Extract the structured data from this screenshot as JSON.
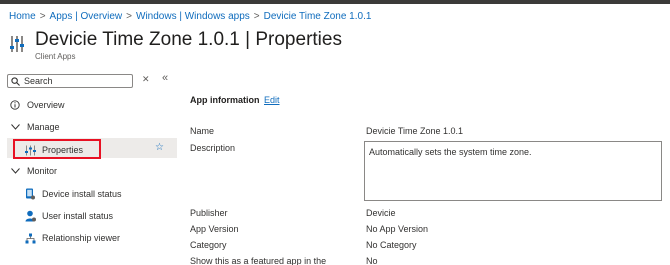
{
  "breadcrumb": [
    "Home",
    "Apps | Overview",
    "Windows | Windows apps",
    "Devicie Time Zone 1.0.1"
  ],
  "header": {
    "title": "Devicie Time Zone 1.0.1 | Properties",
    "subtitle": "Client Apps",
    "more": "···"
  },
  "search": {
    "placeholder": "Search"
  },
  "sidebar": {
    "overview": "Overview",
    "manage": "Manage",
    "properties": "Properties",
    "monitor": "Monitor",
    "device_install_status": "Device install status",
    "user_install_status": "User install status",
    "relationship_viewer": "Relationship viewer"
  },
  "main": {
    "section_title": "App information",
    "edit_label": "Edit",
    "labels": {
      "name": "Name",
      "description": "Description",
      "publisher": "Publisher",
      "app_version": "App Version",
      "category": "Category",
      "featured": "Show this as a featured app in the"
    },
    "values": {
      "name": "Devicie Time Zone 1.0.1",
      "description": "Automatically sets the system time zone.",
      "publisher": "Devicie",
      "app_version": "No App Version",
      "category": "No Category",
      "featured": "No"
    }
  },
  "colors": {
    "accent": "#0f6cbd",
    "highlight": "#e81123",
    "selected_bg": "#edebe9"
  },
  "icons": [
    "app-settings-icon",
    "search-icon",
    "clear-icon",
    "collapse-icon",
    "info-icon",
    "chevron-down-icon",
    "sliders-icon",
    "star-icon",
    "device-icon",
    "user-icon",
    "relationship-icon"
  ]
}
